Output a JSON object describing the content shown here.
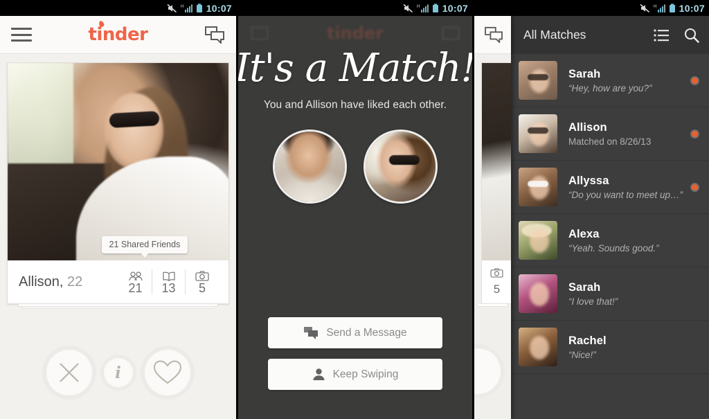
{
  "statusbar": {
    "time": "10:07",
    "network": "H",
    "icons": [
      "mute-icon",
      "signal-icon",
      "battery-icon"
    ]
  },
  "colors": {
    "brand_orange": "#ef6449",
    "unread_dot": "#e8612f",
    "status_time": "#a9dbe8",
    "card_bg": "#ffffff",
    "match_list_bg": "#3d3d3d",
    "match_header_bg": "#333333",
    "overlay_bg": "#3b3b39"
  },
  "panel1": {
    "name": "discovery-card-screen",
    "header": {
      "logo": "tinder",
      "menu_icon": "hamburger-icon",
      "chat_icon": "chat-bubbles-icon"
    },
    "card": {
      "shared_friends_badge": "21 Shared Friends",
      "name": "Allison,",
      "age": "22",
      "stats": [
        {
          "icon": "friends-icon",
          "value": "21"
        },
        {
          "icon": "book-icon",
          "value": "13"
        },
        {
          "icon": "camera-icon",
          "value": "5"
        }
      ]
    },
    "actions": [
      {
        "name": "nope-button",
        "icon": "x-icon"
      },
      {
        "name": "info-button",
        "icon": "info-icon",
        "glyph": "i"
      },
      {
        "name": "like-button",
        "icon": "heart-icon"
      }
    ]
  },
  "panel2": {
    "name": "its-a-match-overlay",
    "title": "It's a Match!",
    "subtitle": "You and Allison have liked each other.",
    "avatars": [
      {
        "name": "your-avatar"
      },
      {
        "name": "match-avatar"
      }
    ],
    "buttons": [
      {
        "name": "send-a-message-button",
        "label": "Send a Message",
        "icon": "chat-bubbles-icon"
      },
      {
        "name": "keep-swiping-button",
        "label": "Keep Swiping",
        "icon": "person-icon"
      }
    ]
  },
  "panel3": {
    "name": "all-matches-screen",
    "peek": {
      "chat_icon": "chat-bubbles-icon",
      "camera_icon": "camera-icon",
      "photo_count": "5"
    },
    "header": {
      "title": "All Matches",
      "list_icon": "list-icon",
      "search_icon": "search-icon"
    },
    "matches": [
      {
        "name": "Sarah",
        "message": "“Hey, how are you?”",
        "italic": true,
        "unread": true,
        "avatar": "a1"
      },
      {
        "name": "Allison",
        "message": "Matched on 8/26/13",
        "italic": false,
        "unread": true,
        "avatar": "a2"
      },
      {
        "name": "Allyssa",
        "message": "“Do you want to meet up…”",
        "italic": true,
        "unread": true,
        "avatar": "a3"
      },
      {
        "name": "Alexa",
        "message": "“Yeah. Sounds good.”",
        "italic": true,
        "unread": false,
        "avatar": "a4"
      },
      {
        "name": "Sarah",
        "message": "“I love that!”",
        "italic": true,
        "unread": false,
        "avatar": "a5"
      },
      {
        "name": "Rachel",
        "message": "“Nice!”",
        "italic": true,
        "unread": false,
        "avatar": "a6"
      }
    ]
  }
}
